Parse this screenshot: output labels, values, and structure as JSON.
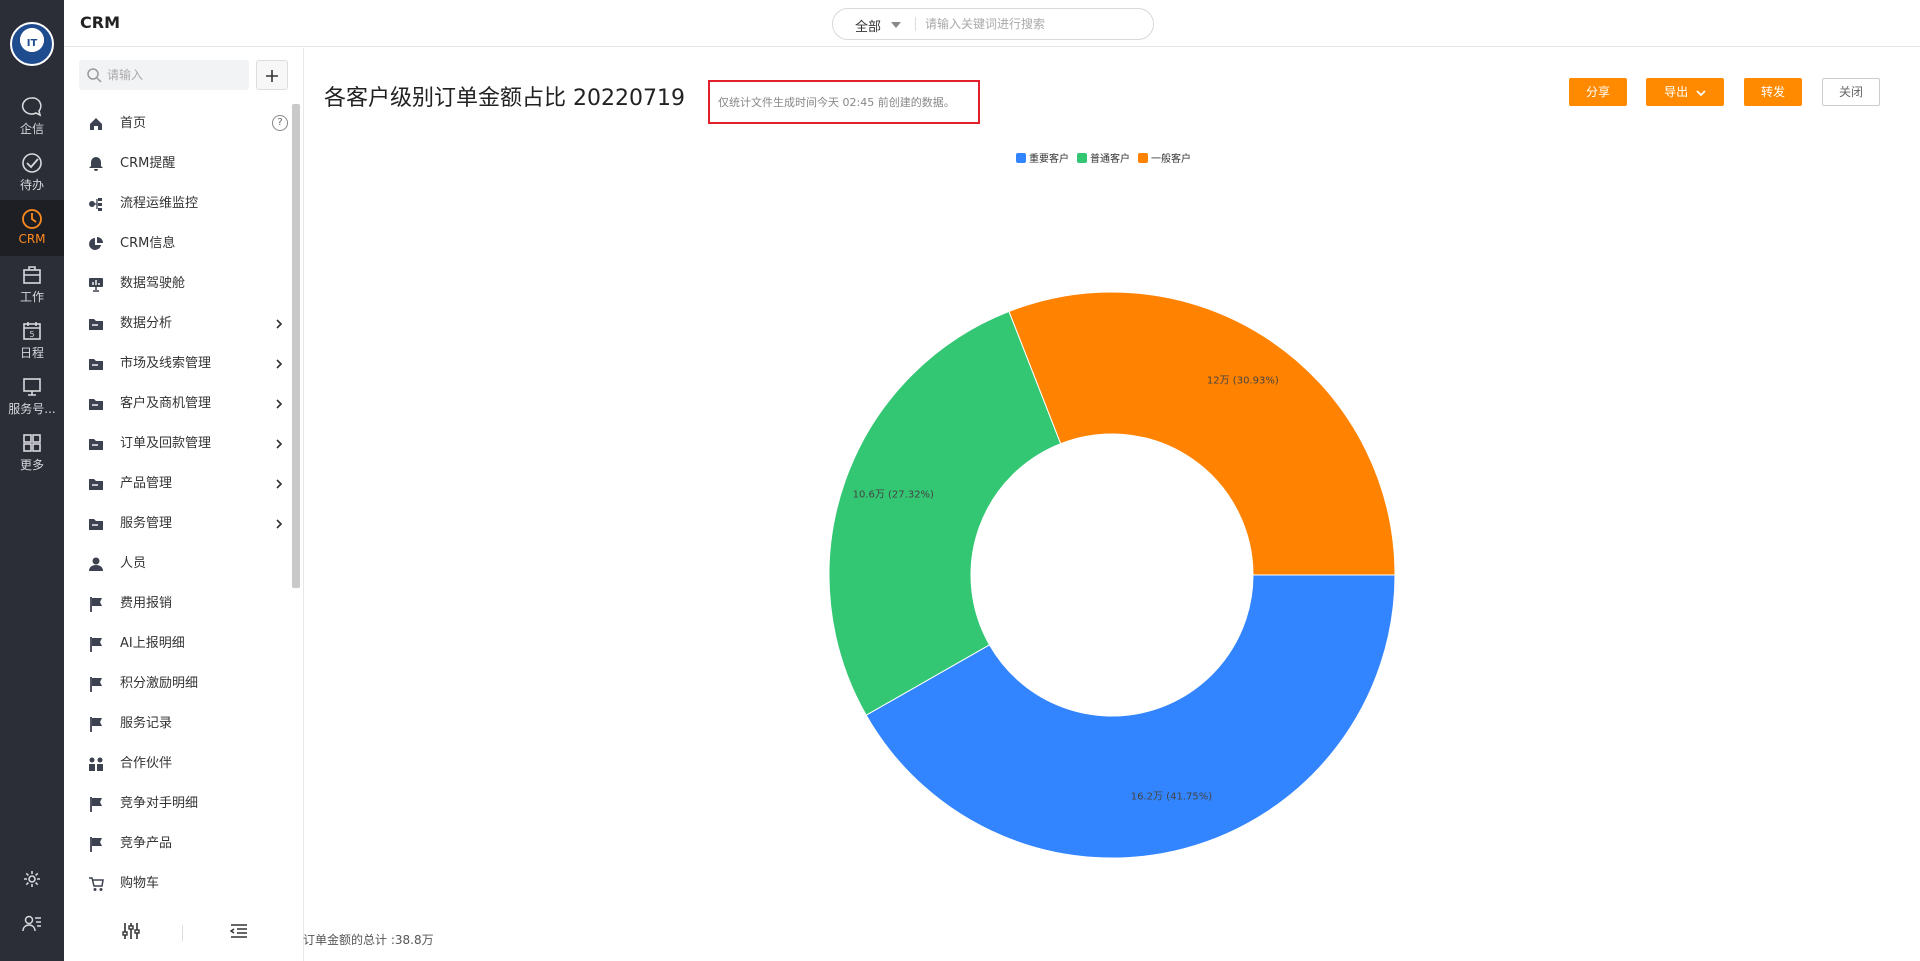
{
  "app": {
    "title": "CRM"
  },
  "rail": {
    "avatar_text": "IT",
    "items": [
      {
        "label": "企信",
        "icon": "chat-icon"
      },
      {
        "label": "待办",
        "icon": "check-circle-icon"
      },
      {
        "label": "CRM",
        "icon": "clock-icon"
      },
      {
        "label": "工作",
        "icon": "briefcase-icon"
      },
      {
        "label": "日程",
        "icon": "calendar-icon"
      },
      {
        "label": "服务号...",
        "icon": "monitor-icon"
      },
      {
        "label": "更多",
        "icon": "grid-icon"
      }
    ]
  },
  "search": {
    "scope": "全部",
    "placeholder": "请输入关键词进行搜索"
  },
  "sidebar": {
    "search_placeholder": "请输入",
    "items": [
      {
        "label": "首页",
        "icon": "home-icon"
      },
      {
        "label": "CRM提醒",
        "icon": "bell-icon"
      },
      {
        "label": "流程运维监控",
        "icon": "flow-icon"
      },
      {
        "label": "CRM信息",
        "icon": "pie-icon"
      },
      {
        "label": "数据驾驶舱",
        "icon": "dashboard-icon"
      },
      {
        "label": "数据分析",
        "icon": "folder-icon"
      },
      {
        "label": "市场及线索管理",
        "icon": "folder-icon"
      },
      {
        "label": "客户及商机管理",
        "icon": "folder-icon"
      },
      {
        "label": "订单及回款管理",
        "icon": "folder-icon"
      },
      {
        "label": "产品管理",
        "icon": "folder-icon"
      },
      {
        "label": "服务管理",
        "icon": "folder-icon"
      },
      {
        "label": "人员",
        "icon": "person-icon"
      },
      {
        "label": "费用报销",
        "icon": "flag-icon"
      },
      {
        "label": "AI上报明细",
        "icon": "flag-icon"
      },
      {
        "label": "积分激励明细",
        "icon": "flag-icon"
      },
      {
        "label": "服务记录",
        "icon": "flag-icon"
      },
      {
        "label": "合作伙伴",
        "icon": "partners-icon"
      },
      {
        "label": "竞争对手明细",
        "icon": "flag-icon"
      },
      {
        "label": "竞争产品",
        "icon": "flag-icon"
      },
      {
        "label": "购物车",
        "icon": "cart-icon"
      }
    ],
    "help_mark": "?"
  },
  "report": {
    "title": "各客户级别订单金额占比 20220719",
    "notice": "仅统计文件生成时间今天 02:45 前创建的数据。",
    "buttons": {
      "share": "分享",
      "export": "导出",
      "forward": "转发",
      "close": "关闭"
    },
    "total": "订单金额的总计 :38.8万"
  },
  "colors": {
    "accent": "#ff8a00",
    "rail_bg": "#2b2e36",
    "notice_border": "#e0202a"
  },
  "chart_data": {
    "type": "pie",
    "style": "donut",
    "legend_position": "top-center",
    "series": [
      {
        "name": "重要客户",
        "value": 16.2,
        "label": "16.2万 (41.75%)",
        "percent": 41.75,
        "color": "#3385ff"
      },
      {
        "name": "普通客户",
        "value": 10.6,
        "label": "10.6万 (27.32%)",
        "percent": 27.32,
        "color": "#33c774"
      },
      {
        "name": "一般客户",
        "value": 12,
        "label": "12万 (30.93%)",
        "percent": 30.93,
        "color": "#ff8200"
      }
    ]
  }
}
